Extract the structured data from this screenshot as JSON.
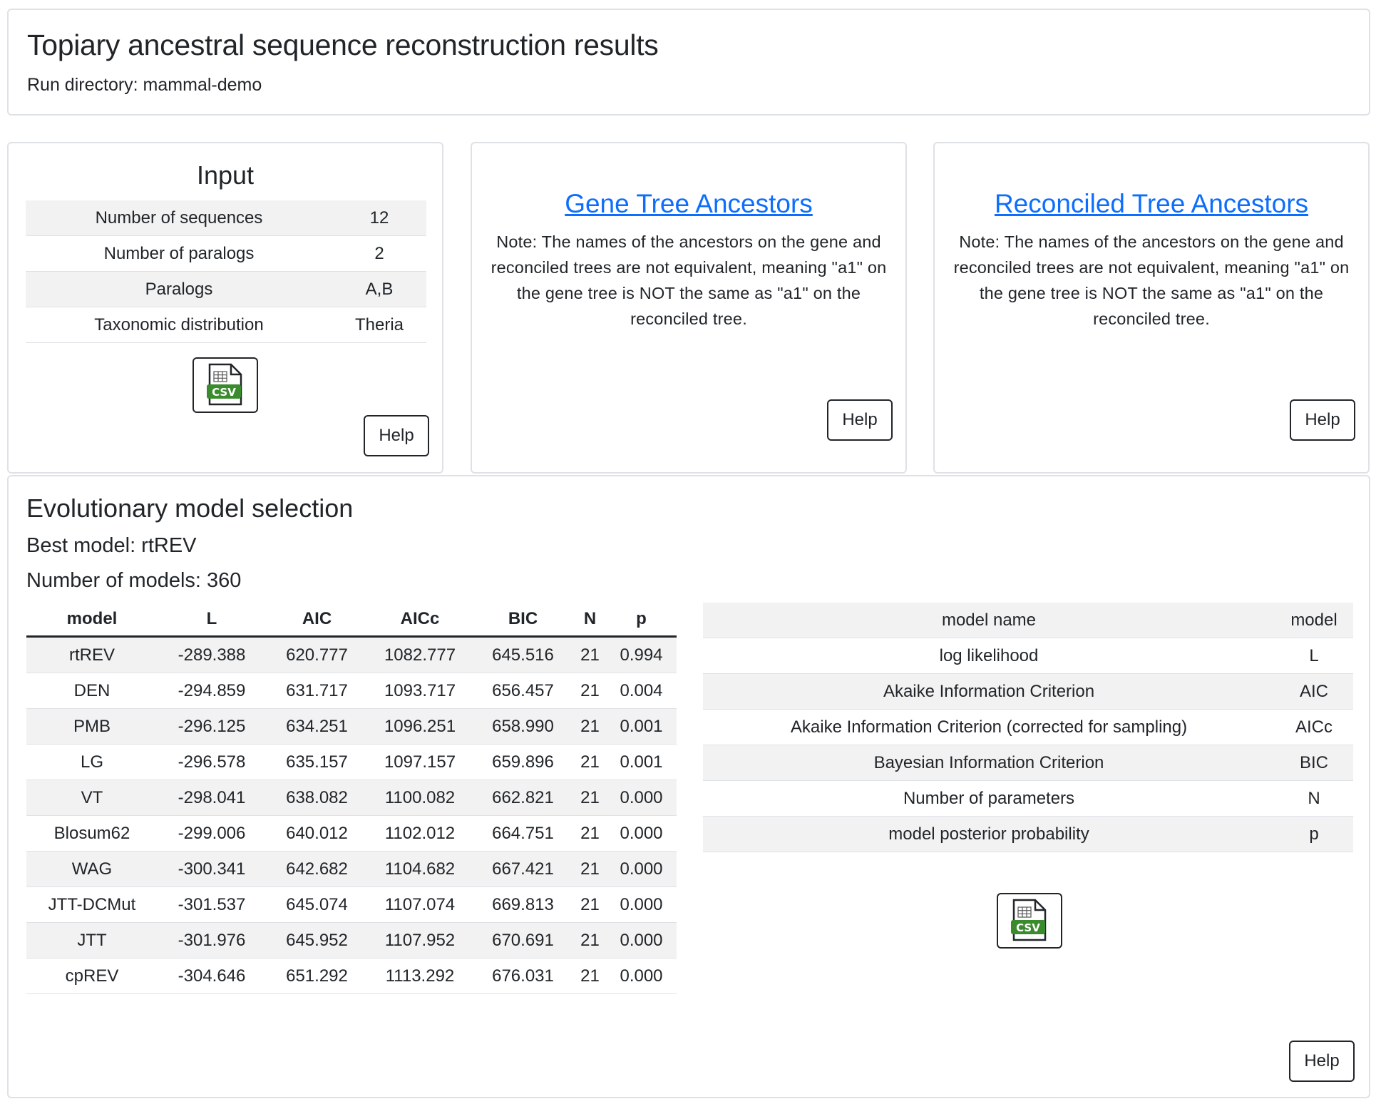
{
  "header": {
    "title": "Topiary ancestral sequence reconstruction results",
    "run_directory": "Run directory: mammal-demo"
  },
  "input": {
    "title": "Input",
    "rows": [
      {
        "key": "Number of sequences",
        "value": "12"
      },
      {
        "key": "Number of paralogs",
        "value": "2"
      },
      {
        "key": "Paralogs",
        "value": "A,B"
      },
      {
        "key": "Taxonomic distribution",
        "value": "Theria"
      }
    ],
    "csv_icon": "csv-file-icon",
    "help_label": "Help"
  },
  "gene_tree": {
    "title": "Gene Tree Ancestors",
    "note": "Note: The names of the ancestors on the gene and reconciled trees are not equivalent, meaning \"a1\" on the gene tree is NOT the same as \"a1\" on the reconciled tree.",
    "help_label": "Help"
  },
  "reconciled_tree": {
    "title": "Reconciled Tree Ancestors",
    "note": "Note: The names of the ancestors on the gene and reconciled trees are not equivalent, meaning \"a1\" on the gene tree is NOT the same as \"a1\" on the reconciled tree.",
    "help_label": "Help"
  },
  "model_selection": {
    "title": "Evolutionary model selection",
    "best_model": "Best model: rtREV",
    "number_of_models": "Number of models: 360",
    "columns": [
      "model",
      "L",
      "AIC",
      "AICc",
      "BIC",
      "N",
      "p"
    ],
    "rows": [
      [
        "rtREV",
        "-289.388",
        "620.777",
        "1082.777",
        "645.516",
        "21",
        "0.994"
      ],
      [
        "DEN",
        "-294.859",
        "631.717",
        "1093.717",
        "656.457",
        "21",
        "0.004"
      ],
      [
        "PMB",
        "-296.125",
        "634.251",
        "1096.251",
        "658.990",
        "21",
        "0.001"
      ],
      [
        "LG",
        "-296.578",
        "635.157",
        "1097.157",
        "659.896",
        "21",
        "0.001"
      ],
      [
        "VT",
        "-298.041",
        "638.082",
        "1100.082",
        "662.821",
        "21",
        "0.000"
      ],
      [
        "Blosum62",
        "-299.006",
        "640.012",
        "1102.012",
        "664.751",
        "21",
        "0.000"
      ],
      [
        "WAG",
        "-300.341",
        "642.682",
        "1104.682",
        "667.421",
        "21",
        "0.000"
      ],
      [
        "JTT-DCMut",
        "-301.537",
        "645.074",
        "1107.074",
        "669.813",
        "21",
        "0.000"
      ],
      [
        "JTT",
        "-301.976",
        "645.952",
        "1107.952",
        "670.691",
        "21",
        "0.000"
      ],
      [
        "cpREV",
        "-304.646",
        "651.292",
        "1113.292",
        "676.031",
        "21",
        "0.000"
      ]
    ],
    "legend": [
      {
        "name": "model name",
        "abbr": "model"
      },
      {
        "name": "log likelihood",
        "abbr": "L"
      },
      {
        "name": "Akaike Information Criterion",
        "abbr": "AIC"
      },
      {
        "name": "Akaike Information Criterion (corrected for sampling)",
        "abbr": "AICc"
      },
      {
        "name": "Bayesian Information Criterion",
        "abbr": "BIC"
      },
      {
        "name": "Number of parameters",
        "abbr": "N"
      },
      {
        "name": "model posterior probability",
        "abbr": "p"
      }
    ],
    "csv_icon": "csv-file-icon",
    "help_label": "Help"
  },
  "colors": {
    "link": "#0d6efd",
    "csv_badge": "#3a8a2e",
    "border": "#dee2e6",
    "stripe": "#f2f2f2"
  },
  "csv_badge_text": "CSV"
}
